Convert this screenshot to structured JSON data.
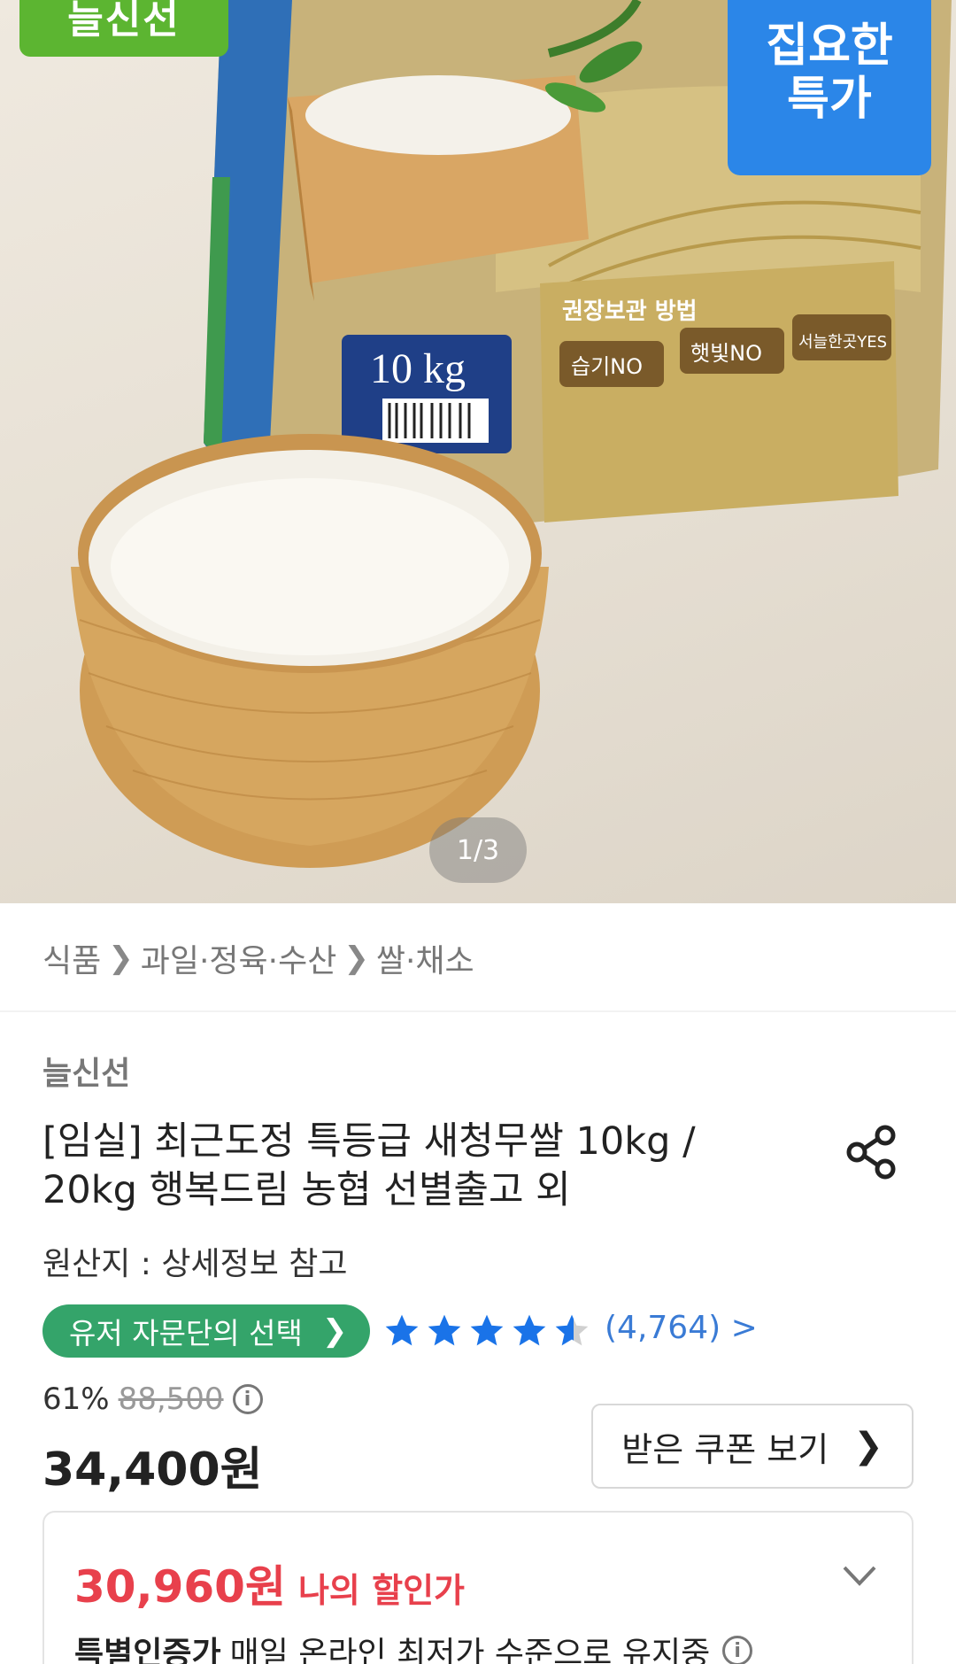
{
  "hero": {
    "brand_badge": "늘신선",
    "deal_badge_line1": "집요한",
    "deal_badge_line2": "특가",
    "bag_weight": "10 kg",
    "bag_storage_title": "권장보관 방법",
    "bag_storage_items": [
      "습기NO",
      "햇빛NO",
      "서늘한곳YES"
    ],
    "pager": "1/3"
  },
  "breadcrumb": {
    "items": [
      "식품",
      "과일·정육·수산",
      "쌀·채소"
    ]
  },
  "product": {
    "seller": "늘신선",
    "title": "[임실] 최근도정 특등급 새청무쌀 10kg / 20kg 행복드림 농협 선별출고 외",
    "origin": "원산지 : 상세정보 참고",
    "advisor_badge": "유저 자문단의 선택",
    "rating": 4.5,
    "review_count": "(4,764)",
    "review_chevron": ">",
    "discount_rate": "61%",
    "original_price": "88,500",
    "price": "34,400원",
    "coupon_button": "받은 쿠폰 보기",
    "my_price": "30,960원",
    "my_price_label": "나의 할인가",
    "special_bold": "특별인증가",
    "special_text": "매일 온라인 최저가 수준으로 유지중"
  },
  "colors": {
    "brand_green": "#5cb531",
    "deal_blue": "#2b86e8",
    "advisor_green": "#34a46a",
    "star_blue": "#1a73e8",
    "link_blue": "#3a7bd5",
    "discount_red": "#e8404c"
  },
  "icons": {
    "share": "share-icon",
    "info": "info-icon",
    "chevron_right": "chevron-right-icon",
    "chevron_down": "chevron-down-icon",
    "star": "star-icon"
  }
}
